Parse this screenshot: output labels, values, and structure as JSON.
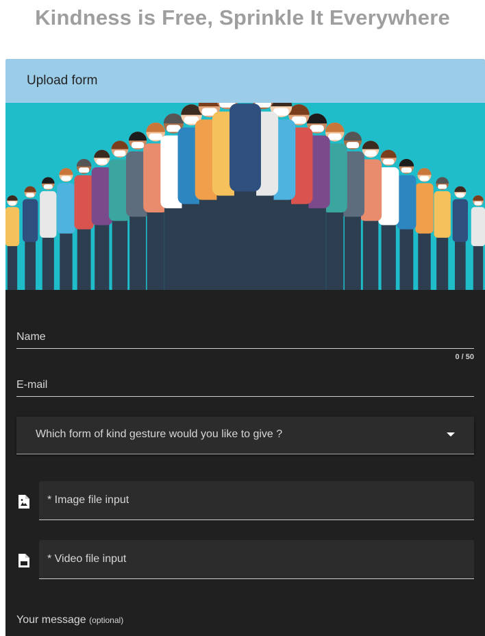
{
  "page": {
    "title": "Kindness is Free, Sprinkle It Everywhere"
  },
  "form": {
    "header": "Upload form",
    "banner_icon": "crowd-of-healthcare-workers-illustration",
    "name": {
      "label": "Name",
      "value": "",
      "counter": "0 / 50"
    },
    "email": {
      "label": "E-mail",
      "value": ""
    },
    "gesture_select": {
      "label": "Which form of kind gesture would you like to give ?",
      "icon": "caret-down-icon"
    },
    "image_input": {
      "label": "* Image file input",
      "icon": "image-file-icon"
    },
    "video_input": {
      "label": "* Video file input",
      "icon": "video-file-icon"
    },
    "message": {
      "label": "Your message",
      "hint": "(optional)"
    }
  },
  "colors": {
    "title": "#9e9e9e",
    "header_bg": "#9ccde8",
    "card_bg": "#202020",
    "field_bg": "#2c2c2c",
    "banner_bg": "#1fbcc9"
  }
}
